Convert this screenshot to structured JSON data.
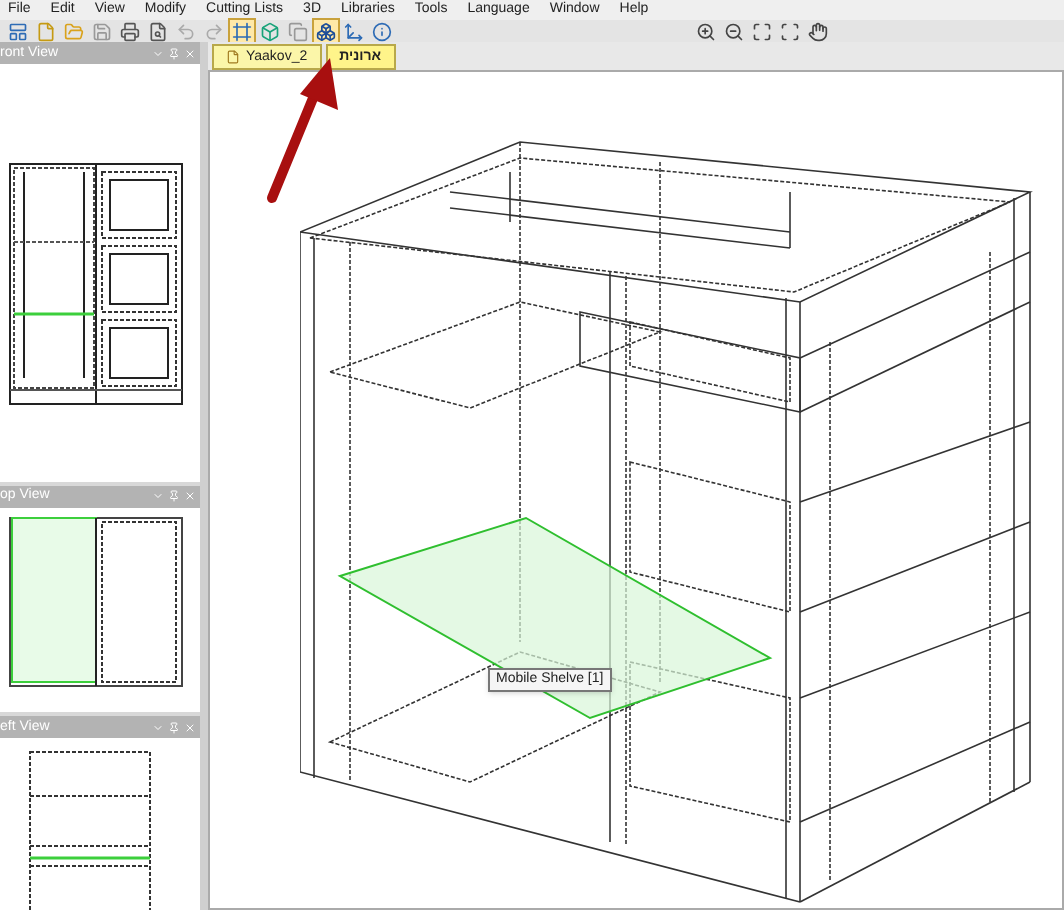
{
  "menu": [
    "File",
    "Edit",
    "View",
    "Modify",
    "Cutting Lists",
    "3D",
    "Libraries",
    "Tools",
    "Language",
    "Window",
    "Help"
  ],
  "toolbar": {
    "left": [
      {
        "kind": "window",
        "selected": false
      },
      {
        "kind": "page",
        "selected": false
      },
      {
        "kind": "folder",
        "selected": false
      },
      {
        "kind": "save",
        "selected": false
      },
      {
        "kind": "printer",
        "selected": false
      },
      {
        "kind": "preview",
        "selected": false
      },
      {
        "kind": "undo",
        "selected": false
      },
      {
        "kind": "redo",
        "selected": false
      },
      {
        "kind": "frame",
        "selected": true
      },
      {
        "kind": "cube",
        "selected": false
      },
      {
        "kind": "copy",
        "selected": false
      },
      {
        "kind": "boxes",
        "selected": true
      },
      {
        "kind": "axes",
        "selected": false
      },
      {
        "kind": "info",
        "selected": false
      }
    ],
    "right": [
      {
        "kind": "zoom-in",
        "selected": false
      },
      {
        "kind": "zoom-out",
        "selected": false
      },
      {
        "kind": "fit",
        "selected": false
      },
      {
        "kind": "zoom-window",
        "selected": false
      },
      {
        "kind": "hand",
        "selected": false
      }
    ]
  },
  "panels": [
    {
      "title": "ront View",
      "kind": "front"
    },
    {
      "title": "op View",
      "kind": "top"
    },
    {
      "title": "eft View",
      "kind": "left"
    }
  ],
  "tabs": [
    {
      "label": "Yaakov_2",
      "selected": false
    },
    {
      "label": "ארונית",
      "selected": true
    }
  ],
  "tooltip": {
    "text": "Mobile Shelve [1]"
  }
}
